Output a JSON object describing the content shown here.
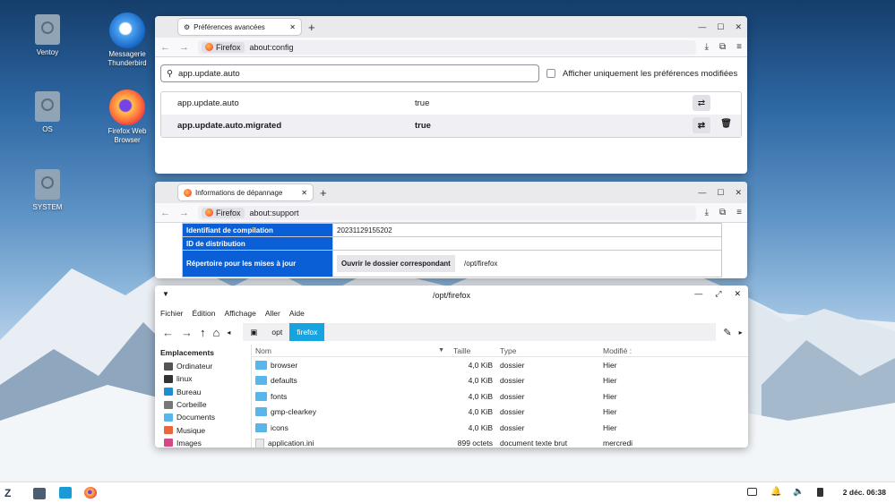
{
  "desktop": {
    "icons": [
      {
        "label": "Ventoy"
      },
      {
        "label": "OS"
      },
      {
        "label": "SYSTEM"
      },
      {
        "label": "Messagerie Thunderbird"
      },
      {
        "label": "Firefox Web Browser"
      }
    ]
  },
  "win_config": {
    "tab_title": "Préférences avancées",
    "identity": "Firefox",
    "url": "about:config",
    "search_value": "app.update.auto",
    "modified_only_label": "Afficher uniquement les préférences modifiées",
    "prefs": [
      {
        "name": "app.update.auto",
        "value": "true"
      },
      {
        "name": "app.update.auto.migrated",
        "value": "true"
      }
    ]
  },
  "win_support": {
    "tab_title": "Informations de dépannage",
    "identity": "Firefox",
    "url": "about:support",
    "rows": [
      {
        "key": "Identifiant de compilation",
        "value": "20231129155202"
      },
      {
        "key": "ID de distribution",
        "value": ""
      },
      {
        "key": "Répertoire pour les mises à jour",
        "button": "Ouvrir le dossier correspondant",
        "value": "/opt/firefox"
      }
    ]
  },
  "file_manager": {
    "title": "/opt/firefox",
    "menu": [
      "Fichier",
      "Édition",
      "Affichage",
      "Aller",
      "Aide"
    ],
    "breadcrumbs": [
      "opt",
      "firefox"
    ],
    "places_header": "Emplacements",
    "places": [
      {
        "label": "Ordinateur",
        "color": "#555555"
      },
      {
        "label": "linux",
        "color": "#333333"
      },
      {
        "label": "Bureau",
        "color": "#1a8fd6"
      },
      {
        "label": "Corbeille",
        "color": "#777777"
      },
      {
        "label": "Documents",
        "color": "#58b6ea"
      },
      {
        "label": "Musique",
        "color": "#e8663c"
      },
      {
        "label": "Images",
        "color": "#d44a86"
      }
    ],
    "columns": {
      "name": "Nom",
      "size": "Taille",
      "type": "Type",
      "modified": "Modifié :"
    },
    "files": [
      {
        "name": "browser",
        "size": "4,0 KiB",
        "type": "dossier",
        "modified": "Hier",
        "kind": "folder"
      },
      {
        "name": "defaults",
        "size": "4,0 KiB",
        "type": "dossier",
        "modified": "Hier",
        "kind": "folder"
      },
      {
        "name": "fonts",
        "size": "4,0 KiB",
        "type": "dossier",
        "modified": "Hier",
        "kind": "folder"
      },
      {
        "name": "gmp-clearkey",
        "size": "4,0 KiB",
        "type": "dossier",
        "modified": "Hier",
        "kind": "folder"
      },
      {
        "name": "icons",
        "size": "4,0 KiB",
        "type": "dossier",
        "modified": "Hier",
        "kind": "folder"
      },
      {
        "name": "application.ini",
        "size": "899 octets",
        "type": "document texte brut",
        "modified": "mercredi",
        "kind": "file"
      }
    ]
  },
  "taskbar": {
    "clock": "2 déc. 06:38"
  }
}
